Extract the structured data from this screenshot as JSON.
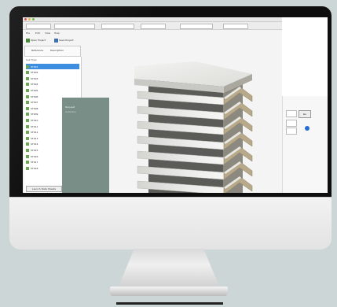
{
  "app": {
    "menu": [
      "File",
      "Edit",
      "View",
      "Help"
    ],
    "actions": [
      "Open Project",
      "Save Project"
    ],
    "table_headers": [
      "Reference",
      "Description"
    ],
    "list_caption": "Sub Type",
    "rows": [
      "ST001",
      "ST002",
      "ST003",
      "ST004",
      "ST005",
      "ST006",
      "ST007",
      "ST008",
      "ST009",
      "ST010",
      "ST011",
      "ST012",
      "ST013",
      "ST014",
      "ST015",
      "ST016",
      "ST017",
      "ST018"
    ],
    "selected_row": 0,
    "bottom_button": "Launch Data Sheets",
    "dialog_title": "Request",
    "dialog_sub": "Available",
    "right_button": "Go"
  },
  "colors": {
    "background": "#ccd6d6",
    "bezel": "#0e0e0e",
    "selection": "#3d8ee0",
    "louvre_face": "#e7e7e4",
    "louvre_edge": "#b7a98a"
  },
  "icons": [
    "window-close-icon",
    "save-icon",
    "folder-icon",
    "checkbox-icon"
  ]
}
